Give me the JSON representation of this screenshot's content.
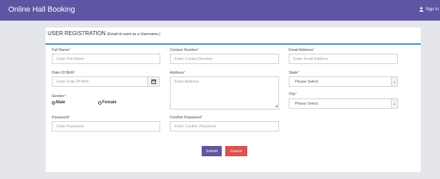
{
  "header": {
    "app_title": "Online Hall Booking",
    "signin_label": "Sign In"
  },
  "form": {
    "title": "USER REGISTRATION",
    "title_note": "(Email id used as a Username.)",
    "full_name": {
      "label": "Full Name",
      "placeholder": "Enter Full Name"
    },
    "contact": {
      "label": "Contact Number",
      "placeholder": "Enter Contact Number"
    },
    "email": {
      "label": "Email Address",
      "placeholder": "Enter Email Address"
    },
    "dob": {
      "label": "Date Of Birth",
      "placeholder": "Enter Date Of Birth"
    },
    "address": {
      "label": "Address",
      "placeholder": "Enter Address"
    },
    "state": {
      "label": "State",
      "value": "Please Select"
    },
    "gender": {
      "label": "Gender",
      "male": "Male",
      "female": "Female",
      "selected": "Male"
    },
    "city": {
      "label": "City",
      "value": "Please Select"
    },
    "password": {
      "label": "Password",
      "placeholder": "Enter Password"
    },
    "confirm_password": {
      "label": "Confirm Password",
      "placeholder": "Enter Confirm Password"
    },
    "required_mark": "*",
    "submit_label": "Submit",
    "cancel_label": "Cancel"
  },
  "colors": {
    "header_bg": "#5e56a2",
    "accent_line": "#3a87c7",
    "submit_bg": "#5e56a2",
    "cancel_bg": "#d9534f"
  }
}
